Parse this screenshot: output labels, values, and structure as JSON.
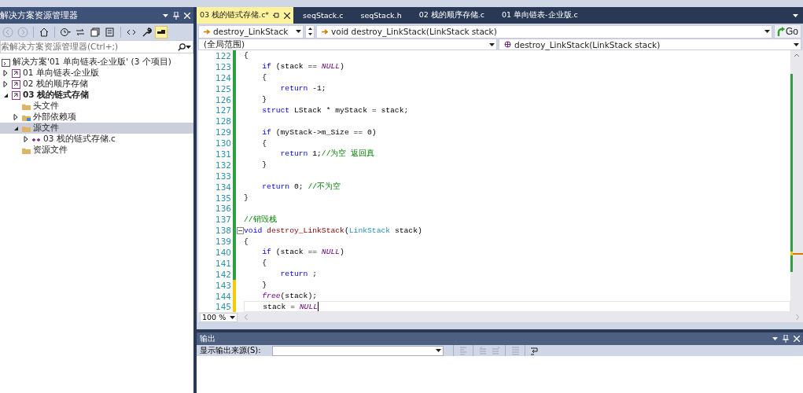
{
  "solution_explorer": {
    "title": "解决方案资源管理器",
    "toolbar": [
      {
        "kind": "back",
        "disabled": true
      },
      {
        "kind": "forward",
        "disabled": true
      },
      {
        "kind": "home",
        "disabled": false
      },
      {
        "kind": "history",
        "disabled": false
      },
      {
        "kind": "sync",
        "disabled": false
      },
      {
        "kind": "collapse",
        "disabled": false
      },
      {
        "kind": "showall",
        "disabled": false
      },
      {
        "kind": "code",
        "disabled": false
      },
      {
        "kind": "wrench",
        "disabled": false
      },
      {
        "kind": "preview",
        "disabled": false,
        "on": true
      }
    ],
    "search": {
      "placeholder": "索解决方案资源管理器(Ctrl+;)"
    },
    "tree": [
      {
        "label": "解决方案'01 单向链表-企业版' (3 个项目)",
        "kind": "solution",
        "selected": false,
        "children": [
          {
            "label": "01 单向链表-企业版",
            "kind": "project",
            "expanded": false,
            "startup": false,
            "selected": false
          },
          {
            "label": "02 栈的顺序存储",
            "kind": "project",
            "expanded": false,
            "startup": false,
            "selected": false
          },
          {
            "label": "03 栈的链式存储",
            "kind": "project",
            "expanded": true,
            "startup": true,
            "selected": false,
            "children": [
              {
                "label": "头文件",
                "kind": "folder",
                "selected": false
              },
              {
                "label": "外部依赖项",
                "kind": "deps",
                "expanded": false,
                "selected": false
              },
              {
                "label": "源文件",
                "kind": "folder",
                "expanded": true,
                "selected": true,
                "children": [
                  {
                    "label": "03 栈的链式存储.c",
                    "kind": "source",
                    "expanded": false,
                    "selected": false
                  }
                ]
              },
              {
                "label": "资源文件",
                "kind": "folder",
                "selected": false
              }
            ]
          }
        ]
      }
    ]
  },
  "tabs": [
    {
      "label": "03 栈的链式存储.c*",
      "selected": true
    },
    {
      "label": "seqStack.c",
      "selected": false
    },
    {
      "label": "seqStack.h",
      "selected": false
    },
    {
      "label": "02 栈的顺序存储.c",
      "selected": false
    },
    {
      "label": "01 单向链表-企业版.c",
      "selected": false
    }
  ],
  "navigation": {
    "member_combo": "destroy_LinkStack",
    "signature_combo": "void destroy_LinkStack(LinkStack stack)",
    "go_button": "Go",
    "scope_combo": "(全局范围)",
    "function_combo": "destroy_LinkStack(LinkStack stack)"
  },
  "code": {
    "lines": [
      {
        "number": "122",
        "saved": true,
        "tokens": [
          {
            "kind": "plain",
            "text": "{"
          }
        ]
      },
      {
        "number": "123",
        "saved": true,
        "tokens": [
          {
            "kind": "keyword",
            "text": "    if"
          },
          {
            "kind": "plain",
            "text": " (stack == "
          },
          {
            "kind": "macro",
            "text": "NULL"
          },
          {
            "kind": "plain",
            "text": ")"
          }
        ]
      },
      {
        "number": "124",
        "saved": true,
        "tokens": [
          {
            "kind": "plain",
            "text": "    {"
          }
        ]
      },
      {
        "number": "125",
        "saved": true,
        "tokens": [
          {
            "kind": "keyword",
            "text": "        return"
          },
          {
            "kind": "plain",
            "text": " -1;"
          }
        ]
      },
      {
        "number": "126",
        "saved": true,
        "tokens": [
          {
            "kind": "plain",
            "text": "    }"
          }
        ]
      },
      {
        "number": "127",
        "saved": true,
        "tokens": [
          {
            "kind": "keyword",
            "text": "    struct"
          },
          {
            "kind": "plain",
            "text": " LStack * myStack = stack;"
          }
        ]
      },
      {
        "number": "128",
        "saved": true
      },
      {
        "number": "129",
        "saved": true,
        "tokens": [
          {
            "kind": "keyword",
            "text": "    if"
          },
          {
            "kind": "plain",
            "text": " (myStack->m_Size == 0)"
          }
        ]
      },
      {
        "number": "130",
        "saved": true,
        "tokens": [
          {
            "kind": "plain",
            "text": "    {"
          }
        ]
      },
      {
        "number": "131",
        "saved": true,
        "tokens": [
          {
            "kind": "keyword",
            "text": "        return"
          },
          {
            "kind": "plain",
            "text": " 1;"
          },
          {
            "kind": "comment",
            "text": "//为空 返回真"
          }
        ]
      },
      {
        "number": "132",
        "saved": true,
        "tokens": [
          {
            "kind": "plain",
            "text": "    }"
          }
        ]
      },
      {
        "number": "133",
        "saved": true
      },
      {
        "number": "134",
        "saved": true,
        "tokens": [
          {
            "kind": "keyword",
            "text": "    return"
          },
          {
            "kind": "plain",
            "text": " 0; "
          },
          {
            "kind": "comment",
            "text": "//不为空"
          }
        ]
      },
      {
        "number": "135",
        "saved": true,
        "tokens": [
          {
            "kind": "plain",
            "text": "}"
          }
        ]
      },
      {
        "number": "136",
        "saved": true
      },
      {
        "number": "137",
        "saved": true,
        "tokens": [
          {
            "kind": "comment",
            "text": "//销毁栈"
          }
        ]
      },
      {
        "number": "138",
        "saved": true,
        "fold": true,
        "tokens": [
          {
            "kind": "keyword",
            "text": "void"
          },
          {
            "kind": "function",
            "text": " destroy_LinkStack"
          },
          {
            "kind": "plain",
            "text": "("
          },
          {
            "kind": "type",
            "text": "LinkStack"
          },
          {
            "kind": "plain",
            "text": " stack)"
          }
        ]
      },
      {
        "number": "139",
        "saved": true,
        "tokens": [
          {
            "kind": "plain",
            "text": "{"
          }
        ]
      },
      {
        "number": "140",
        "saved": true,
        "tokens": [
          {
            "kind": "keyword",
            "text": "    if"
          },
          {
            "kind": "plain",
            "text": " (stack == "
          },
          {
            "kind": "macro",
            "text": "NULL"
          },
          {
            "kind": "plain",
            "text": ")"
          }
        ]
      },
      {
        "number": "141",
        "saved": true,
        "tokens": [
          {
            "kind": "plain",
            "text": "    {"
          }
        ]
      },
      {
        "number": "142",
        "saved": true,
        "tokens": [
          {
            "kind": "keyword",
            "text": "        return"
          },
          {
            "kind": "plain",
            "text": " ;"
          }
        ]
      },
      {
        "number": "143",
        "saved": false,
        "tokens": [
          {
            "kind": "plain",
            "text": "    }"
          }
        ]
      },
      {
        "number": "144",
        "saved": false,
        "tokens": [
          {
            "kind": "macro",
            "text": "    free"
          },
          {
            "kind": "plain",
            "text": "(stack);"
          }
        ]
      },
      {
        "number": "145",
        "saved": false,
        "caret": true,
        "tokens": [
          {
            "kind": "plain",
            "text": "    stack = "
          },
          {
            "kind": "macro",
            "text": "NULL"
          }
        ]
      }
    ]
  },
  "zoom": "100 %",
  "output": {
    "title": "输出",
    "source_label": "显示输出来源(S):",
    "toolbar": [
      {
        "kind": "find",
        "disabled": true
      },
      {
        "kind": "previous",
        "disabled": true
      },
      {
        "kind": "next",
        "disabled": true
      },
      {
        "kind": "clear",
        "disabled": true
      },
      {
        "kind": "wrap",
        "disabled": false
      }
    ]
  }
}
